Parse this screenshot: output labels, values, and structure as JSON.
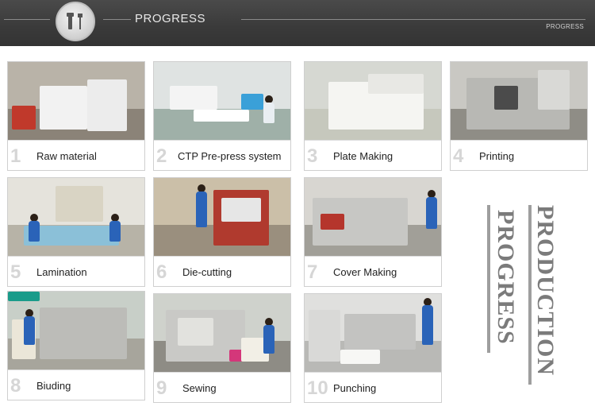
{
  "header": {
    "title": "PROGRESS",
    "subtitle": "PROGRESS",
    "logo_icon": "tools-icon"
  },
  "steps": [
    {
      "number": "1",
      "label": "Raw material"
    },
    {
      "number": "2",
      "label": "CTP Pre-press system"
    },
    {
      "number": "3",
      "label": "Plate Making"
    },
    {
      "number": "4",
      "label": "Printing"
    },
    {
      "number": "5",
      "label": "Lamination"
    },
    {
      "number": "6",
      "label": "Die-cutting"
    },
    {
      "number": "7",
      "label": "Cover Making"
    },
    {
      "number": "8",
      "label": "Biuding"
    },
    {
      "number": "9",
      "label": "Sewing"
    },
    {
      "number": "10",
      "label": "Punching"
    }
  ],
  "side_title": {
    "word1": "PRODUCTION",
    "word2": "PROGRESS"
  },
  "colors": {
    "header_bg": "#3a3a3a",
    "worker_uniform": "#2a63b8",
    "caption_number": "#d6d6d6",
    "side_text": "#7b7b7b"
  }
}
